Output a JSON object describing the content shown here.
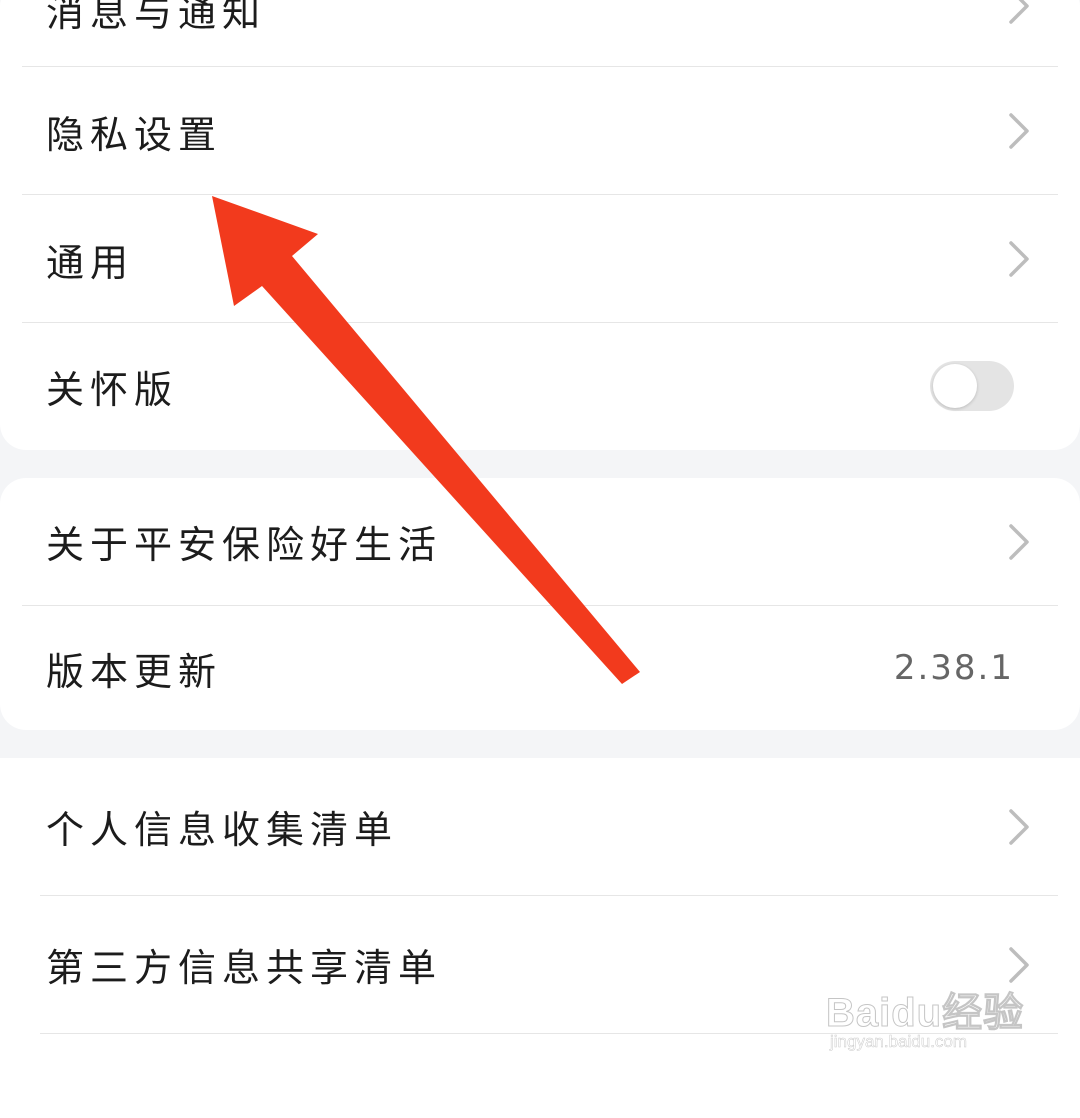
{
  "settings": {
    "group1": {
      "items": [
        {
          "label": "消息与通知"
        },
        {
          "label": "隐私设置"
        },
        {
          "label": "通用"
        },
        {
          "label": "关怀版",
          "toggle_state": "off"
        }
      ]
    },
    "group2": {
      "items": [
        {
          "label": "关于平安保险好生活"
        },
        {
          "label": "版本更新",
          "value": "2.38.1"
        }
      ]
    },
    "group3": {
      "items": [
        {
          "label": "个人信息收集清单"
        },
        {
          "label": "第三方信息共享清单"
        }
      ]
    }
  },
  "annotation": {
    "arrow_color": "#f23a1d"
  },
  "watermark": {
    "logo_text": "Baidu经验",
    "url": "jingyan.baidu.com"
  },
  "icons": [
    "chevron-right-icon",
    "toggle-switch"
  ]
}
